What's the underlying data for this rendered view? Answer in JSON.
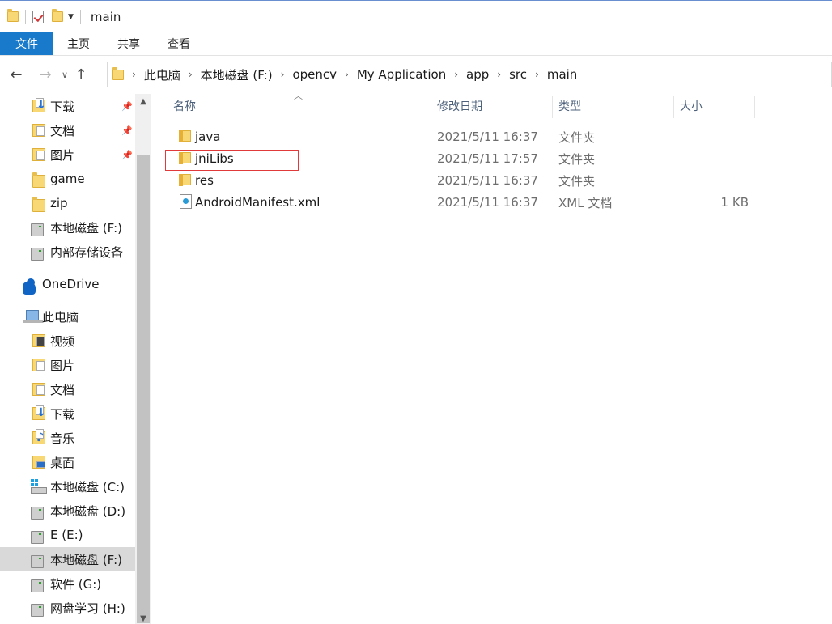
{
  "window": {
    "title": "main"
  },
  "ribbon": {
    "tabs": [
      "文件",
      "主页",
      "共享",
      "查看"
    ]
  },
  "address": {
    "crumbs": [
      "此电脑",
      "本地磁盘 (F:)",
      "opencv",
      "My Application",
      "app",
      "src",
      "main"
    ]
  },
  "sidebar": {
    "items": [
      {
        "label": "下载",
        "icon": "download-folder-icon",
        "pinned": true
      },
      {
        "label": "文档",
        "icon": "documents-folder-icon",
        "pinned": true
      },
      {
        "label": "图片",
        "icon": "pictures-folder-icon",
        "pinned": true
      },
      {
        "label": "game",
        "icon": "folder-icon",
        "pinned": false
      },
      {
        "label": "zip",
        "icon": "folder-icon",
        "pinned": false
      },
      {
        "label": "本地磁盘 (F:)",
        "icon": "drive-icon",
        "pinned": false
      },
      {
        "label": "内部存储设备",
        "icon": "drive-icon",
        "pinned": false
      },
      {
        "label": "OneDrive",
        "icon": "onedrive-cloud-icon",
        "pinned": false
      },
      {
        "label": "此电脑",
        "icon": "this-pc-icon",
        "pinned": false
      },
      {
        "label": "视频",
        "icon": "videos-folder-icon",
        "pinned": false
      },
      {
        "label": "图片",
        "icon": "pictures-folder-icon",
        "pinned": false
      },
      {
        "label": "文档",
        "icon": "documents-folder-icon",
        "pinned": false
      },
      {
        "label": "下载",
        "icon": "download-folder-icon",
        "pinned": false
      },
      {
        "label": "音乐",
        "icon": "music-folder-icon",
        "pinned": false
      },
      {
        "label": "桌面",
        "icon": "desktop-folder-icon",
        "pinned": false
      },
      {
        "label": "本地磁盘 (C:)",
        "icon": "windows-drive-icon",
        "pinned": false
      },
      {
        "label": "本地磁盘 (D:)",
        "icon": "drive-icon",
        "pinned": false
      },
      {
        "label": "E (E:)",
        "icon": "drive-icon",
        "pinned": false
      },
      {
        "label": "本地磁盘 (F:)",
        "icon": "drive-icon",
        "pinned": false,
        "selected": true
      },
      {
        "label": "软件 (G:)",
        "icon": "drive-icon",
        "pinned": false
      },
      {
        "label": "网盘学习 (H:)",
        "icon": "drive-icon",
        "pinned": false
      }
    ]
  },
  "list": {
    "columns": {
      "name": "名称",
      "date": "修改日期",
      "type": "类型",
      "size": "大小"
    },
    "rows": [
      {
        "name": "java",
        "date": "2021/5/11 16:37",
        "type": "文件夹",
        "size": "",
        "icon": "folder-icon"
      },
      {
        "name": "jniLibs",
        "date": "2021/5/11 17:57",
        "type": "文件夹",
        "size": "",
        "icon": "folder-icon"
      },
      {
        "name": "res",
        "date": "2021/5/11 16:37",
        "type": "文件夹",
        "size": "",
        "icon": "folder-icon"
      },
      {
        "name": "AndroidManifest.xml",
        "date": "2021/5/11 16:37",
        "type": "XML 文档",
        "size": "1 KB",
        "icon": "xml-file-icon"
      }
    ]
  },
  "colors": {
    "file_tab": "#1979ca",
    "highlight_box": "#e03a3a",
    "selected_nav": "#d9d9d9"
  }
}
